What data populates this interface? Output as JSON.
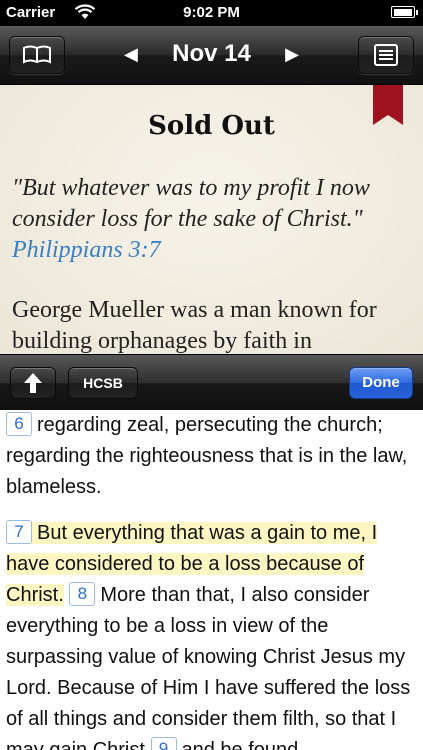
{
  "status_bar": {
    "carrier": "Carrier",
    "time": "9:02 PM"
  },
  "navbar": {
    "date": "Nov 14",
    "prev_glyph": "◀",
    "next_glyph": "▶",
    "left_icon": "book-icon",
    "right_icon": "list-icon"
  },
  "devotional": {
    "title": "Sold Out",
    "quote": "\"But whatever was to my profit I now consider loss for the sake of Christ.\"",
    "quote_ref": "Philippians 3:7",
    "body": "George Mueller was a man known for building orphanages by faith in"
  },
  "toolbar": {
    "up_icon": "arrow-up-icon",
    "version": "HCSB",
    "done": "Done"
  },
  "passage": {
    "v6": {
      "num": "6",
      "text": "regarding zeal, persecuting the church; regarding the righteousness that is in the law, blameless."
    },
    "v7": {
      "num": "7",
      "text": "But everything that was a gain to me, I have considered to be a loss because of Christ."
    },
    "v8": {
      "num": "8",
      "text": "More than that, I also consider everything to be a loss in view of the surpassing value of knowing Christ Jesus my Lord. Because of Him I have suffered the loss of all things and consider them filth, so that I may gain Christ"
    },
    "v9": {
      "num": "9",
      "text": "and be found"
    }
  },
  "colors": {
    "accent_blue": "#3a7fc0",
    "done_blue": "#2f6be0",
    "ribbon_red": "#a01220",
    "highlight": "#fdf6c3"
  }
}
